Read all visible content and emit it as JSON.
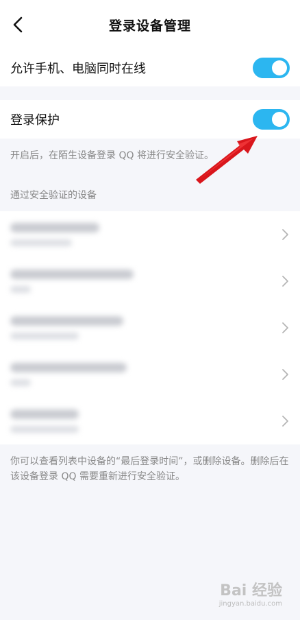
{
  "header": {
    "title": "登录设备管理"
  },
  "settings": {
    "allow_online_label": "允许手机、电脑同时在线",
    "login_protect_label": "登录保护",
    "protect_hint": "开启后，在陌生设备登录 QQ 将进行安全验证。"
  },
  "devices_section": {
    "title": "通过安全验证的设备"
  },
  "devices": [
    {},
    {},
    {},
    {},
    {}
  ],
  "footer": {
    "note": "你可以查看列表中设备的“最后登录时间”，或删除设备。删除后在该设备登录 QQ 需要重新进行安全验证。"
  },
  "watermark": {
    "brand": "Bai 经验",
    "url": "jingyan.baidu.com"
  },
  "colors": {
    "toggle_on": "#2cb6f0",
    "arrow": "#d9161c"
  }
}
